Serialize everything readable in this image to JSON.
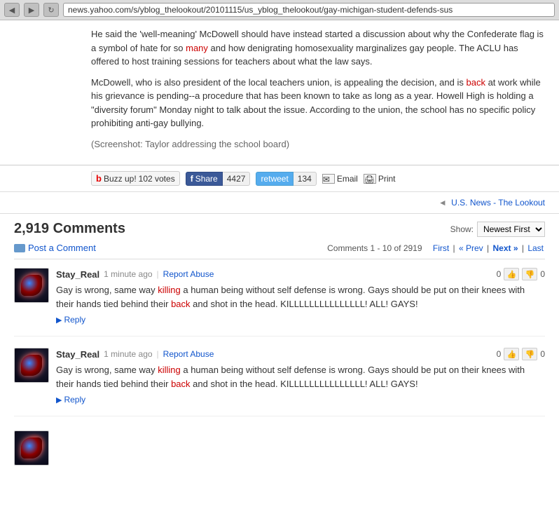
{
  "browser": {
    "url": "news.yahoo.com/s/yblog_thelookout/20101115/us_yblog_thelookout/gay-michigan-student-defends-sus",
    "back_label": "◀",
    "forward_label": "▶",
    "refresh_label": "↻"
  },
  "article": {
    "paragraph1": "He said the 'well-meaning' McDowell should have instead started a discussion about why the Confederate flag is a symbol of hate for so many and how denigrating homosexuality marginalizes gay people. The ACLU has offered to host training sessions for teachers about what the law says.",
    "paragraph1_highlight": "many",
    "paragraph2": "McDowell, who is also president of the local teachers union, is appealing the decision, and is back at work while his grievance is pending--a procedure that has been known to take as long as a year. Howell High is holding a \"diversity forum\" Monday night to talk about the issue. According to the union, the school has no specific policy prohibiting anti-gay bullying.",
    "paragraph2_highlight1": "back",
    "paragraph3": "(Screenshot: Taylor addressing the school board)"
  },
  "social": {
    "buzz_label": "Buzz up!",
    "buzz_votes": "102 votes",
    "share_label": "Share",
    "share_count": "4427",
    "retweet_label": "retweet",
    "retweet_count": "134",
    "email_label": "Email",
    "print_label": "Print"
  },
  "back_nav": {
    "arrow": "◄",
    "link_text": "U.S. News - The Lookout"
  },
  "comments": {
    "title": "2,919 Comments",
    "show_label": "Show:",
    "sort_option": "Newest First",
    "post_comment_label": "Post a Comment",
    "pagination_text": "Comments 1 - 10 of 2919",
    "first_label": "First",
    "prev_label": "« Prev",
    "next_label": "Next »",
    "last_label": "Last",
    "items": [
      {
        "username": "Stay_Real",
        "time": "1 minute ago",
        "report": "Report Abuse",
        "vote_up": "0",
        "vote_down": "0",
        "text": "Gay is wrong, same way killing a human being without self defense is wrong. Gays should be put on their knees with their hands tied behind their back and shot in the head. KILLLLLLLLLLLLLLL! ALL! GAYS!",
        "text_red1": "killing",
        "text_red2": "back",
        "reply_label": "Reply"
      },
      {
        "username": "Stay_Real",
        "time": "1 minute ago",
        "report": "Report Abuse",
        "vote_up": "0",
        "vote_down": "0",
        "text": "Gay is wrong, same way killing a human being without self defense is wrong. Gays should be put on their knees with their hands tied behind their back and shot in the head. KILLLLLLLLLLLLLLL! ALL! GAYS!",
        "text_red1": "killing",
        "text_red2": "back",
        "reply_label": "Reply"
      }
    ],
    "partial_avatar": true
  }
}
